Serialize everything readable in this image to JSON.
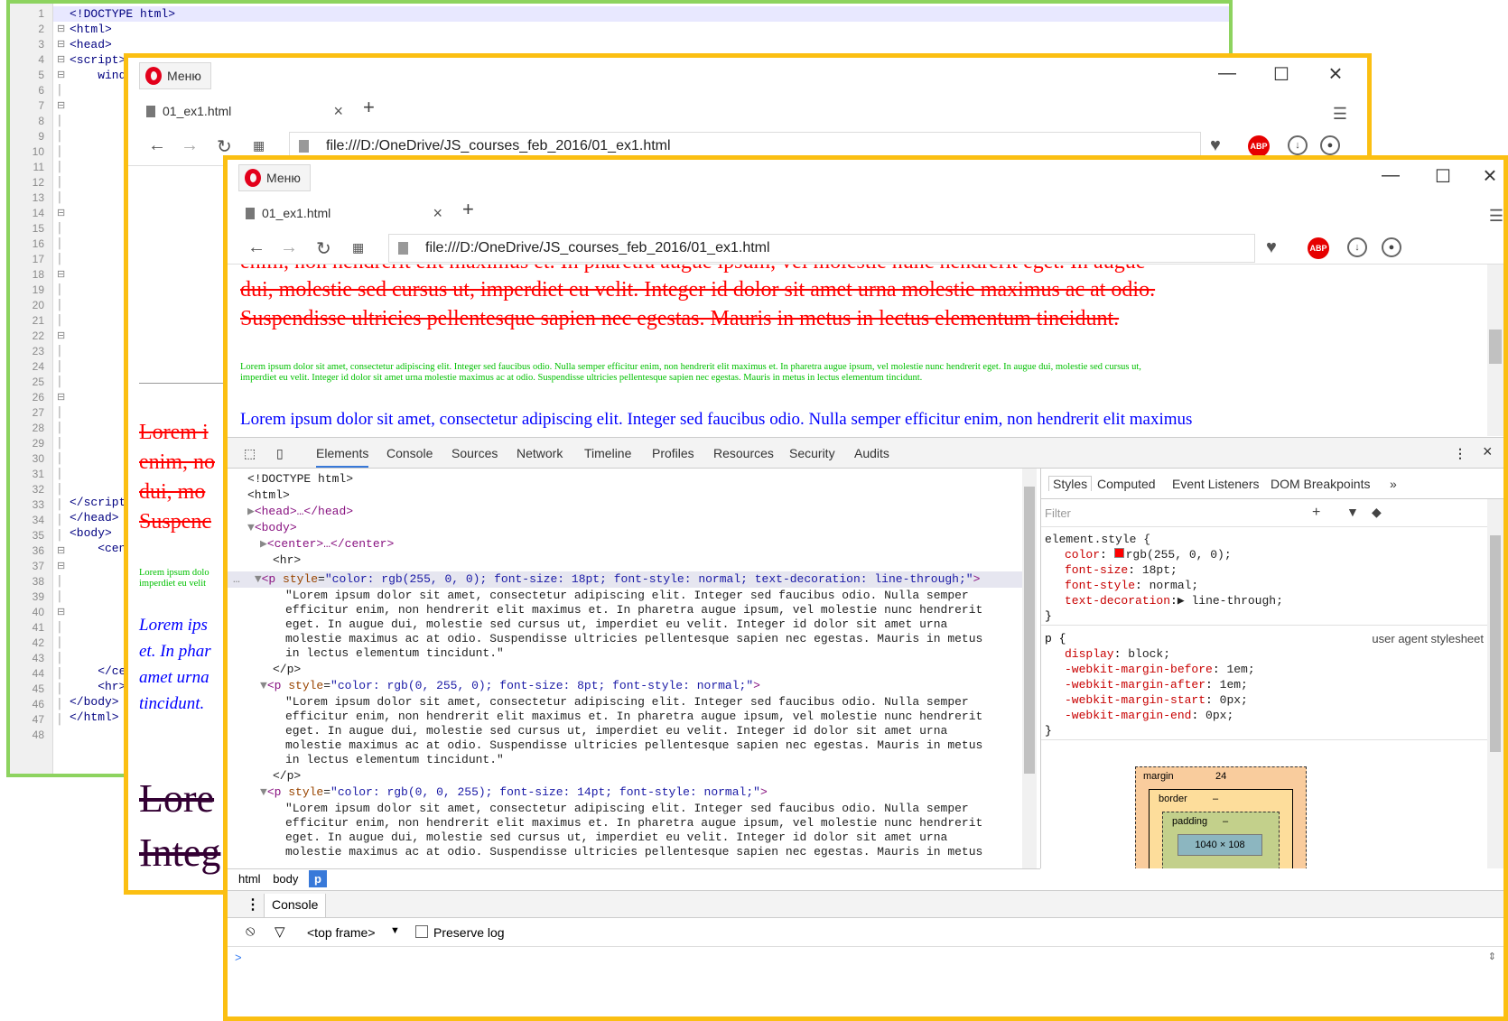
{
  "editor": {
    "line_numbers": [
      "1",
      "2",
      "3",
      "4",
      "5",
      "6",
      "7",
      "8",
      "9",
      "10",
      "11",
      "12",
      "13",
      "14",
      "15",
      "16",
      "17",
      "18",
      "19",
      "20",
      "21",
      "22",
      "23",
      "24",
      "25",
      "26",
      "27",
      "28",
      "29",
      "30",
      "31",
      "32",
      "33",
      "34",
      "35",
      "36",
      "37",
      "38",
      "39",
      "40",
      "41",
      "42",
      "43",
      "44",
      "45",
      "46",
      "47",
      "48"
    ],
    "lines": {
      "l1": "<!DOCTYPE html>",
      "l2": "<html>",
      "l3": "<head>",
      "l4": "<script>",
      "l5": "    wind",
      "l33": "        }",
      "l34": "</script",
      "l35": "</head>",
      "l36": "<body>",
      "l37": "    <cen",
      "l45": "    </ce",
      "l46": "    <hr>",
      "l47": "</body>",
      "l48": "</html>"
    }
  },
  "browser": {
    "menu_label": "Меню",
    "tab_title": "01_ex1.html",
    "tab_close": "×",
    "new_tab": "+",
    "url": "file:///D:/OneDrive/JS_courses_feb_2016/01_ex1.html",
    "minimize": "—",
    "maximize": "☐",
    "close": "×",
    "abp_label": "ABP"
  },
  "back_page": {
    "red_lines": [
      "Lorem i",
      "enim, no",
      "dui, mo",
      "Suspenc"
    ],
    "green_lines": [
      "Lorem ipsum dolo",
      "imperdiet eu velit"
    ],
    "blue_lines": [
      "Lorem ips",
      "et. In phar",
      "amet urna",
      "tincidunt."
    ],
    "big_lines": [
      "Lore",
      "Integ"
    ]
  },
  "front_page": {
    "red_line1": "enim, non hendrerit elit maximus et. In pharetra augue ipsum, vel molestie nunc hendrerit eget. In augue",
    "red_line2": "dui, molestie sed cursus ut, imperdiet eu velit. Integer id dolor sit amet urna molestie maximus ac at odio.",
    "red_line3": "Suspendisse ultricies pellentesque sapien nec egestas. Mauris in metus in lectus elementum tincidunt.",
    "green_line1": "Lorem ipsum dolor sit amet, consectetur adipiscing elit. Integer sed faucibus odio. Nulla semper efficitur enim, non hendrerit elit maximus et. In pharetra augue ipsum, vel molestie nunc hendrerit eget. In augue dui, molestie sed cursus ut,",
    "green_line2": "imperdiet eu velit. Integer id dolor sit amet urna molestie maximus ac at odio. Suspendisse ultricies pellentesque sapien nec egestas. Mauris in metus in lectus elementum tincidunt.",
    "blue_line": "Lorem ipsum dolor sit amet, consectetur adipiscing elit. Integer sed faucibus odio. Nulla semper efficitur enim, non hendrerit elit maximus"
  },
  "devtools": {
    "tabs": [
      "Elements",
      "Console",
      "Sources",
      "Network",
      "Timeline",
      "Profiles",
      "Resources",
      "Security",
      "Audits"
    ],
    "doctype": "<!DOCTYPE html>",
    "html_open": "<html>",
    "head": "<head>…</head>",
    "body_open": "<body>",
    "center": "<center>…</center>",
    "hr": "<hr>",
    "p1_open_tag": "<p ",
    "p1_attr_name": "style",
    "p1_attr_value": "\"color: rgb(255, 0, 0); font-size: 18pt; font-style: normal; text-decoration: line-through;\"",
    "p2_attr_value": "\"color: rgb(0, 255, 0); font-size: 8pt; font-style: normal;\"",
    "p3_attr_value": "\"color: rgb(0, 0, 255); font-size: 14pt; font-style: normal;\"",
    "tag_close": ">",
    "p_close": "</p>",
    "text_lines_1": [
      "\"Lorem ipsum dolor sit amet, consectetur adipiscing elit. Integer sed faucibus odio. Nulla semper",
      "efficitur enim, non hendrerit elit maximus et. In pharetra augue ipsum, vel molestie nunc hendrerit",
      "eget. In augue dui, molestie sed cursus ut, imperdiet eu velit. Integer id dolor sit amet urna",
      "molestie maximus ac at odio. Suspendisse ultricies pellentesque sapien nec egestas. Mauris in metus",
      "in lectus elementum tincidunt.\""
    ],
    "text_lines_3": [
      "\"Lorem ipsum dolor sit amet, consectetur adipiscing elit. Integer sed faucibus odio. Nulla semper",
      "efficitur enim, non hendrerit elit maximus et. In pharetra augue ipsum, vel molestie nunc hendrerit",
      "eget. In augue dui, molestie sed cursus ut, imperdiet eu velit. Integer id dolor sit amet urna",
      "molestie maximus ac at odio. Suspendisse ultricies pellentesque sapien nec egestas. Mauris in metus"
    ],
    "ellipsis": "…",
    "breadcrumbs": [
      "html",
      "body",
      "p"
    ],
    "side_tabs": [
      "Styles",
      "Computed",
      "Event Listeners",
      "DOM Breakpoints",
      "»"
    ],
    "filter_placeholder": "Filter",
    "element_style": "element.style {",
    "rules": [
      {
        "prop": "color",
        "val": "rgb(255, 0, 0);"
      },
      {
        "prop": "font-size",
        "val": "18pt;"
      },
      {
        "prop": "font-style",
        "val": "normal;"
      },
      {
        "prop": "text-decoration",
        "val": "▶ line-through;"
      }
    ],
    "close_brace": "}",
    "p_selector": "p {",
    "ua_label": "user agent stylesheet",
    "ua_rules": [
      {
        "prop": "display",
        "val": "block;"
      },
      {
        "prop": "-webkit-margin-before",
        "val": "1em;"
      },
      {
        "prop": "-webkit-margin-after",
        "val": "1em;"
      },
      {
        "prop": "-webkit-margin-start",
        "val": "0px;"
      },
      {
        "prop": "-webkit-margin-end",
        "val": "0px;"
      }
    ],
    "boxmodel": {
      "margin_label": "margin",
      "margin_value": "24",
      "border_label": "border",
      "padding_label": "padding",
      "dash": "–",
      "content": "1040 × 108"
    },
    "console": {
      "drawer_tab": "Console",
      "frame": "<top frame>",
      "preserve_log": "Preserve log",
      "prompt": ">"
    }
  },
  "colors": {
    "editor_border": "#8dd35f",
    "window_border": "#fbbf12",
    "swatch_red": "#ff0000"
  }
}
